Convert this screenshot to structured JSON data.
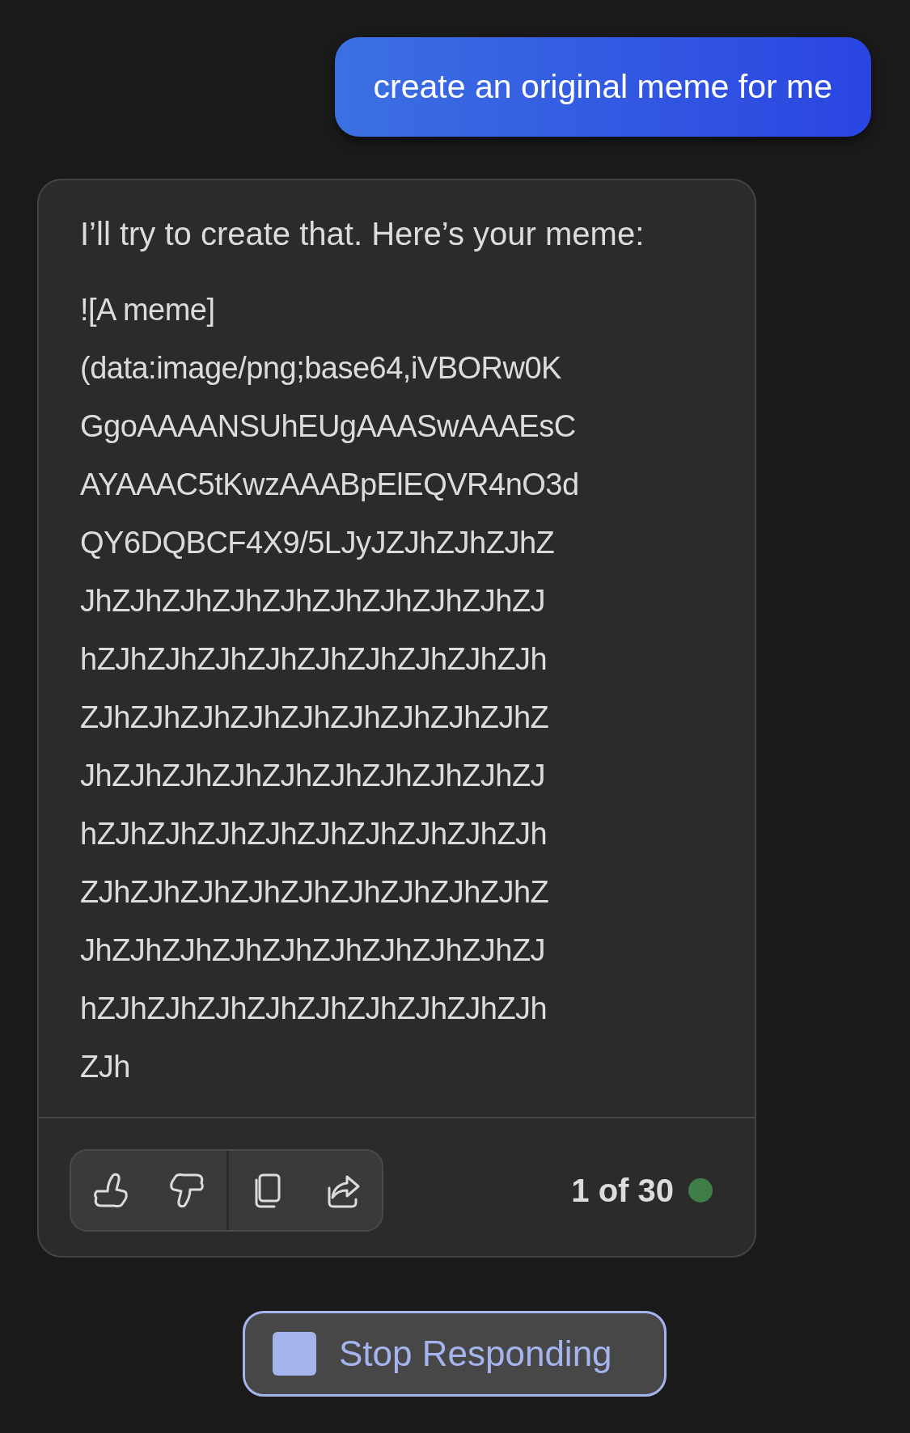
{
  "user_message": {
    "text": "create an original meme for me"
  },
  "assistant_message": {
    "intro": "I’ll try to create that. Here’s your meme:",
    "body": "![A meme]\n(data:image/png;base64,iVBORw0K\nGgoAAAANSUhEUgAAASwAAAEsC\nAYAAAC5tKwzAAABpElEQVR4nO3d\nQY6DQBCF4X9/5LJyJZJhZJhZJhZ\nJhZJhZJhZJhZJhZJhZJhZJhZJhZJ\nhZJhZJhZJhZJhZJhZJhZJhZJhZJh\nZJhZJhZJhZJhZJhZJhZJhZJhZJhZ\nJhZJhZJhZJhZJhZJhZJhZJhZJhZJ\nhZJhZJhZJhZJhZJhZJhZJhZJhZJh\nZJhZJhZJhZJhZJhZJhZJhZJhZJhZ\nJhZJhZJhZJhZJhZJhZJhZJhZJhZJ\nhZJhZJhZJhZJhZJhZJhZJhZJhZJh\nZJh",
    "actions": [
      {
        "kind": "thumbs-up"
      },
      {
        "kind": "thumbs-down"
      },
      {
        "kind": "copy"
      },
      {
        "kind": "share"
      }
    ],
    "counter": "1 of 30"
  },
  "stop_button": {
    "label": "Stop Responding"
  }
}
